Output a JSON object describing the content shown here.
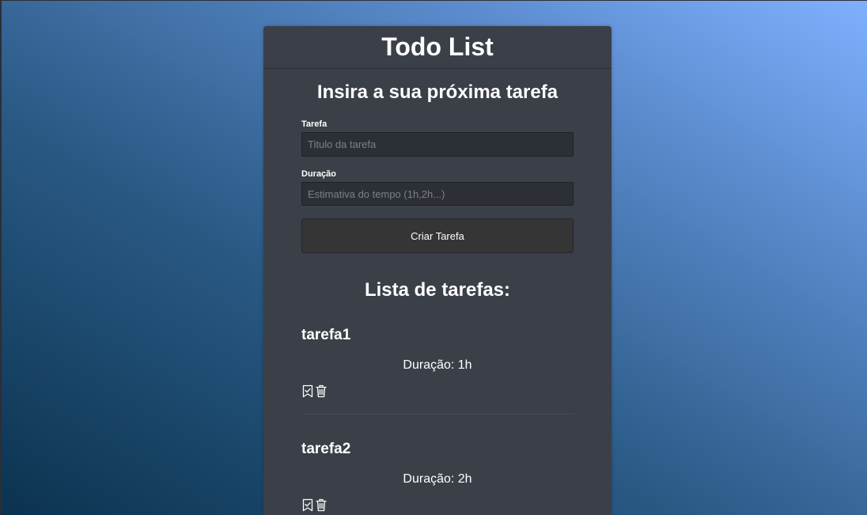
{
  "app": {
    "title": "Todo List"
  },
  "form": {
    "title": "Insira a sua próxima tarefa",
    "task_label": "Tarefa",
    "task_placeholder": "Titulo da tarefa",
    "task_value": "",
    "duration_label": "Duração",
    "duration_placeholder": "Estimativa do tempo (1h,2h...)",
    "duration_value": "",
    "submit_label": "Criar Tarefa"
  },
  "list": {
    "title": "Lista de tarefas:",
    "items": [
      {
        "name": "tarefa1",
        "duration": "Duração: 1h"
      },
      {
        "name": "tarefa2",
        "duration": "Duração: 2h"
      }
    ],
    "actions": [
      "bookmark-check-icon",
      "trash-icon"
    ]
  },
  "colors": {
    "card_background": "#3b3f48",
    "input_background": "#2c2f35",
    "button_background": "#353535",
    "text": "#ffffff",
    "gradient_start": "#0b3350",
    "gradient_end": "#7fb0ff"
  }
}
